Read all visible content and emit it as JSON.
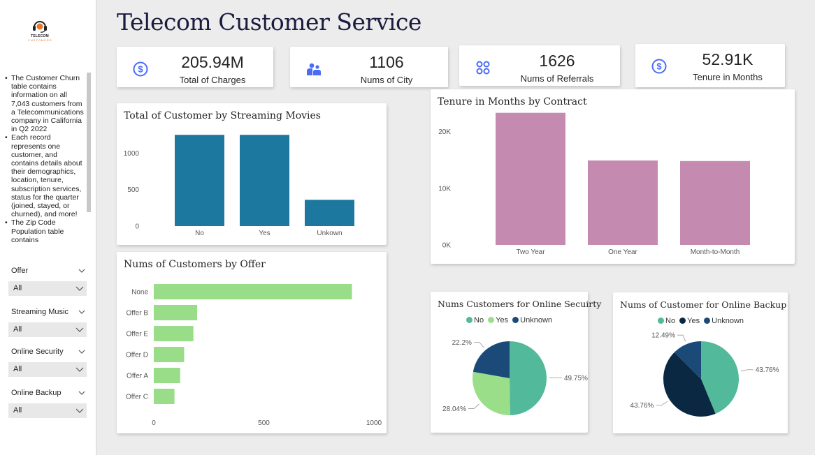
{
  "logo": {
    "name": "TELECOM",
    "sub": "CUSTOMERS"
  },
  "sidebar": {
    "info_items": [
      "The Customer Churn table contains information on all 7,043 customers from a Telecommunications company in California in Q2 2022",
      "Each record represents one customer, and contains details about their demographics, location, tenure, subscription services, status for the quarter (joined, stayed, or churned), and more!",
      "The Zip Code Population table contains"
    ],
    "filters": [
      {
        "label": "Offer",
        "value": "All"
      },
      {
        "label": "Streaming Music",
        "value": "All"
      },
      {
        "label": "Online Security",
        "value": "All"
      },
      {
        "label": "Online Backup",
        "value": "All"
      }
    ]
  },
  "page_title": "Telecom Customer Service",
  "colors": {
    "accent": "#4a6cf7",
    "bar_blue": "#1c789e",
    "bar_pink": "#c48aaf",
    "bar_green": "#99dd88",
    "pie_no": "#52b99a",
    "pie_yes": "#9ade8a",
    "pie_unknown": "#1b4a78",
    "pie_yes_dark": "#0b2842"
  },
  "kpis": [
    {
      "value": "205.94M",
      "label": "Total of Charges",
      "icon": "dollar-icon"
    },
    {
      "value": "1106",
      "label": "Nums of City",
      "icon": "people-icon"
    },
    {
      "value": "1626",
      "label": "Nums of Referrals",
      "icon": "grid-icon"
    },
    {
      "value": "52.91K",
      "label": "Tenure in Months",
      "icon": "dollar-icon"
    }
  ],
  "chart_data": [
    {
      "id": "streaming",
      "type": "bar",
      "title": "Total of Customer by Streaming Movies",
      "categories": [
        "No",
        "Yes",
        "Unkown"
      ],
      "values": [
        1250,
        1250,
        360
      ],
      "yticks": [
        "0",
        "500",
        "1000"
      ],
      "ylim": [
        0,
        1300
      ],
      "color": "#1c789e"
    },
    {
      "id": "tenure",
      "type": "bar",
      "title": "Tenure in Months by Contract",
      "categories": [
        "Two Year",
        "One Year",
        "Month-to-Month"
      ],
      "values": [
        23300,
        14900,
        14800
      ],
      "yticks": [
        "0K",
        "10K",
        "20K"
      ],
      "ylim": [
        0,
        24000
      ],
      "color": "#c48aaf"
    },
    {
      "id": "offer",
      "type": "bar",
      "orientation": "horizontal",
      "title": "Nums of Customers by Offer",
      "categories": [
        "None",
        "Offer B",
        "Offer E",
        "Offer D",
        "Offer A",
        "Offer C"
      ],
      "values": [
        900,
        197,
        180,
        138,
        120,
        94
      ],
      "xticks": [
        "0",
        "500",
        "1000"
      ],
      "xlim": [
        0,
        1000
      ],
      "color": "#99dd88"
    },
    {
      "id": "security",
      "type": "pie",
      "title": "Nums Customers for Online Secuirty",
      "legend": [
        "No",
        "Yes",
        "Unknown"
      ],
      "values": [
        49.75,
        28.04,
        22.2
      ],
      "labels": [
        "49.75%",
        "28.04%",
        "22.2%"
      ],
      "colors": [
        "#52b99a",
        "#9ade8a",
        "#1b4a78"
      ]
    },
    {
      "id": "backup",
      "type": "pie",
      "title": "Nums of Customer for Online Backup",
      "legend": [
        "No",
        "Yes",
        "Unknown"
      ],
      "values": [
        43.76,
        43.76,
        12.49
      ],
      "labels": [
        "43.76%",
        "43.76%",
        "12.49%"
      ],
      "colors": [
        "#52b99a",
        "#0b2842",
        "#1b4a78"
      ]
    }
  ]
}
